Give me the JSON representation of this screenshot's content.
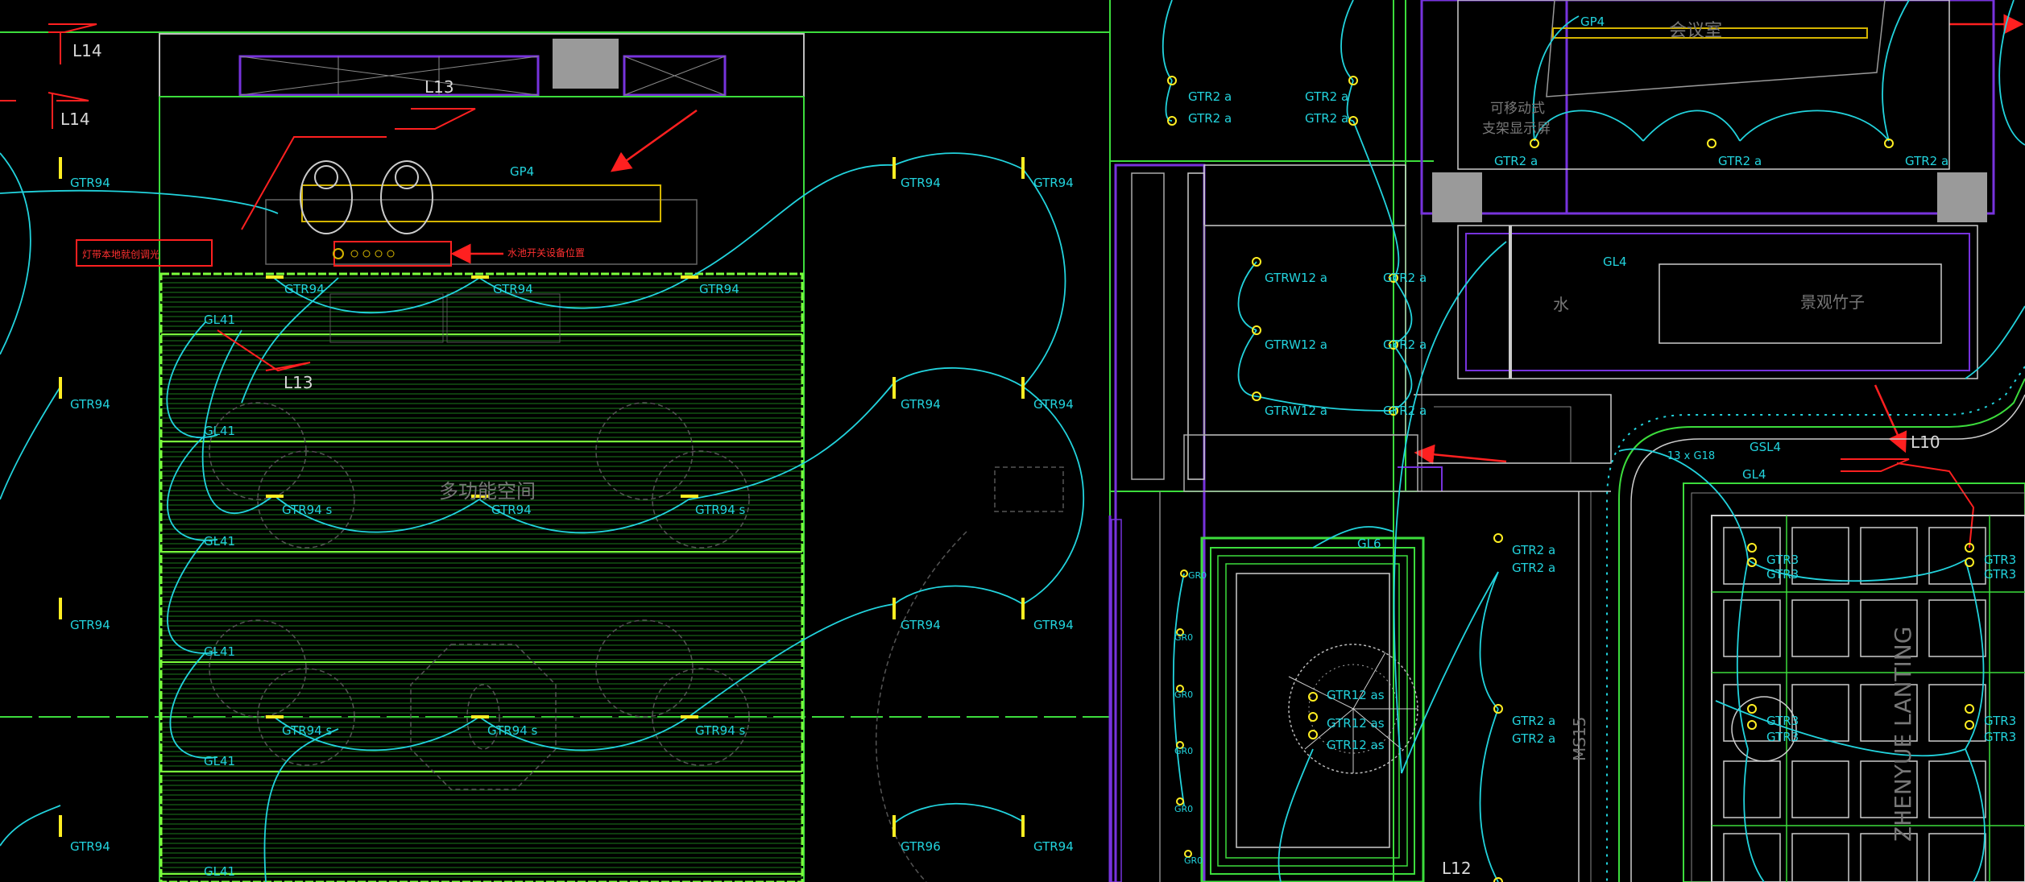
{
  "drawing": {
    "room_labels": {
      "multi_function": "多功能空间",
      "meeting": "会议室",
      "landscape": "景观竹子",
      "water": "水",
      "movable_screen_1": "可移动式",
      "movable_screen_2": "支架显示屏"
    },
    "notes": {
      "floor_dimmer": "灯带本地就创调光",
      "water_switch": "水池开关设备位置"
    },
    "circuit_tags": {
      "L14_a": "L14",
      "L14_b": "L14",
      "L13_top": "L13",
      "L13_mid": "L13",
      "L10": "L10",
      "L12": "L12",
      "GP4_left": "GP4",
      "GP4_right": "GP4",
      "GL4_a": "GL4",
      "GL4_b": "GL4",
      "GSL4": "GSL4",
      "GL6": "GL6",
      "led_strip": "13 x G18",
      "MS": "MS15",
      "vertical_text": "ZHENYUE LANTING"
    },
    "fixture_labels": {
      "gtr94": "GTR94",
      "gtr94s": "GTR94 s",
      "gtr96": "GTR96",
      "gl41": "GL41",
      "gtr2a": "GTR2 a",
      "gtrw12a": "GTRW12 a",
      "gtr12as": "GTR12 as",
      "gtr3": "GTR3",
      "gr0": "GR0"
    }
  },
  "colors": {
    "background": "#000000",
    "wall_green": "#3cdc3c",
    "bright_green": "#7cff3c",
    "cyan_circuit": "#22d3dd",
    "purple_wall": "#7733dd",
    "yellow_fixture": "#ffee22",
    "red_annotation": "#ff2020",
    "gray_column": "#9a9a9a"
  }
}
